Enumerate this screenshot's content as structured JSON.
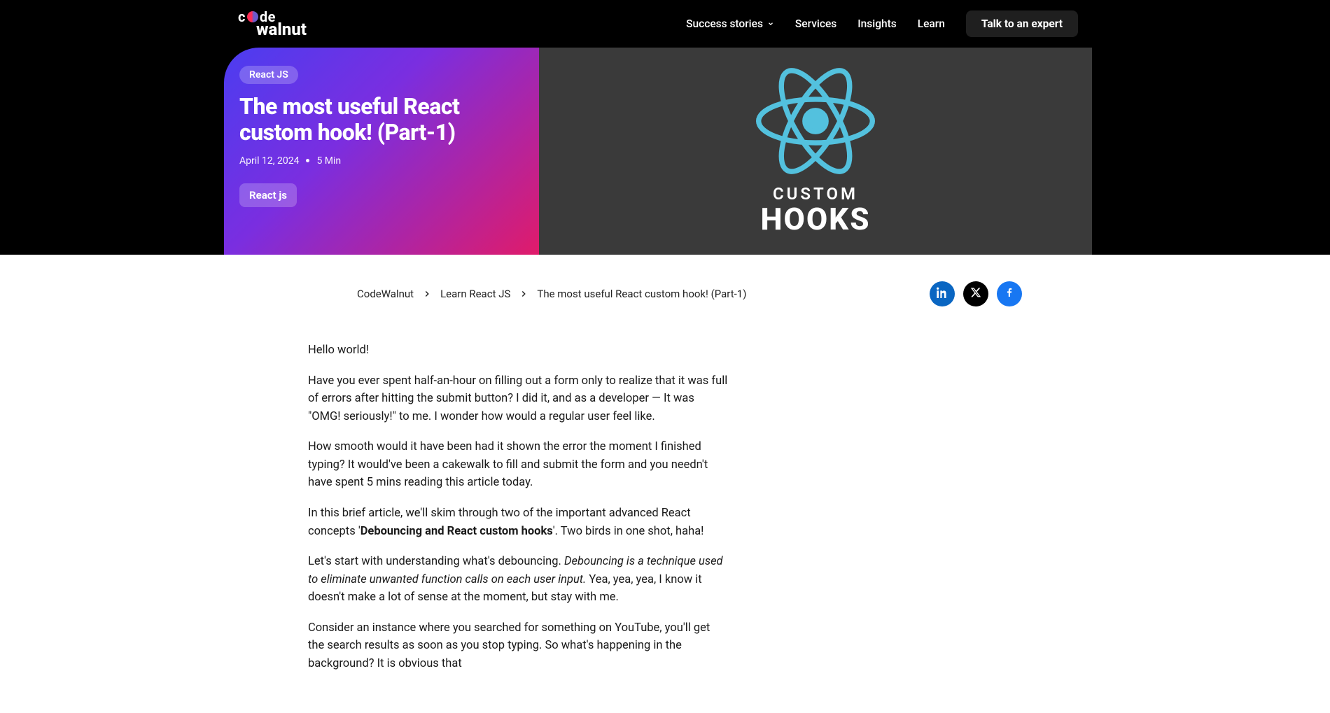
{
  "nav": {
    "logo_line1_a": "c",
    "logo_line1_b": "de",
    "logo_line2": "walnut",
    "items": [
      {
        "label": "Success stories",
        "has_dropdown": true
      },
      {
        "label": "Services",
        "has_dropdown": false
      },
      {
        "label": "Insights",
        "has_dropdown": false
      },
      {
        "label": "Learn",
        "has_dropdown": false
      }
    ],
    "cta": "Talk to an expert"
  },
  "hero": {
    "category_pill": "React JS",
    "title": "The most useful React custom hook! (Part-1)",
    "date": "April 12, 2024",
    "read_time": "5 Min",
    "tag": "React js",
    "graphic_text_line1": "CUSTOM",
    "graphic_text_line2": "HOOKS"
  },
  "breadcrumbs": {
    "item1": "CodeWalnut",
    "item2": "Learn React JS",
    "item3": "The most useful React custom hook! (Part-1)"
  },
  "article": {
    "p1": "Hello world!",
    "p2": "Have you ever spent half-an-hour on filling out a form only to realize that it was full of errors after hitting the submit button? I did it, and as a developer — It was \"OMG! seriously!\" to me. I wonder how would a regular user feel like.",
    "p3": "How smooth would it have been had it shown the error the moment I finished typing? It would've been a cakewalk to fill and submit the form and you needn't have spent 5 mins reading this article today.",
    "p4_a": "In this brief article, we'll skim through two of the important advanced React concepts '",
    "p4_b": "Debouncing and React custom hooks",
    "p4_c": "'. Two birds in one shot, haha!",
    "p5_a": "Let's start with understanding what's debouncing. ",
    "p5_b": "Debouncing is a technique used to eliminate unwanted function calls on each user input.",
    "p5_c": " Yea, yea, yea, I know it doesn't make a lot of sense at the moment, but stay with me.",
    "p6": "Consider an instance where you searched for something on YouTube, you'll get the search results as soon as you stop typing. So what's happening in the background? It is obvious that"
  }
}
